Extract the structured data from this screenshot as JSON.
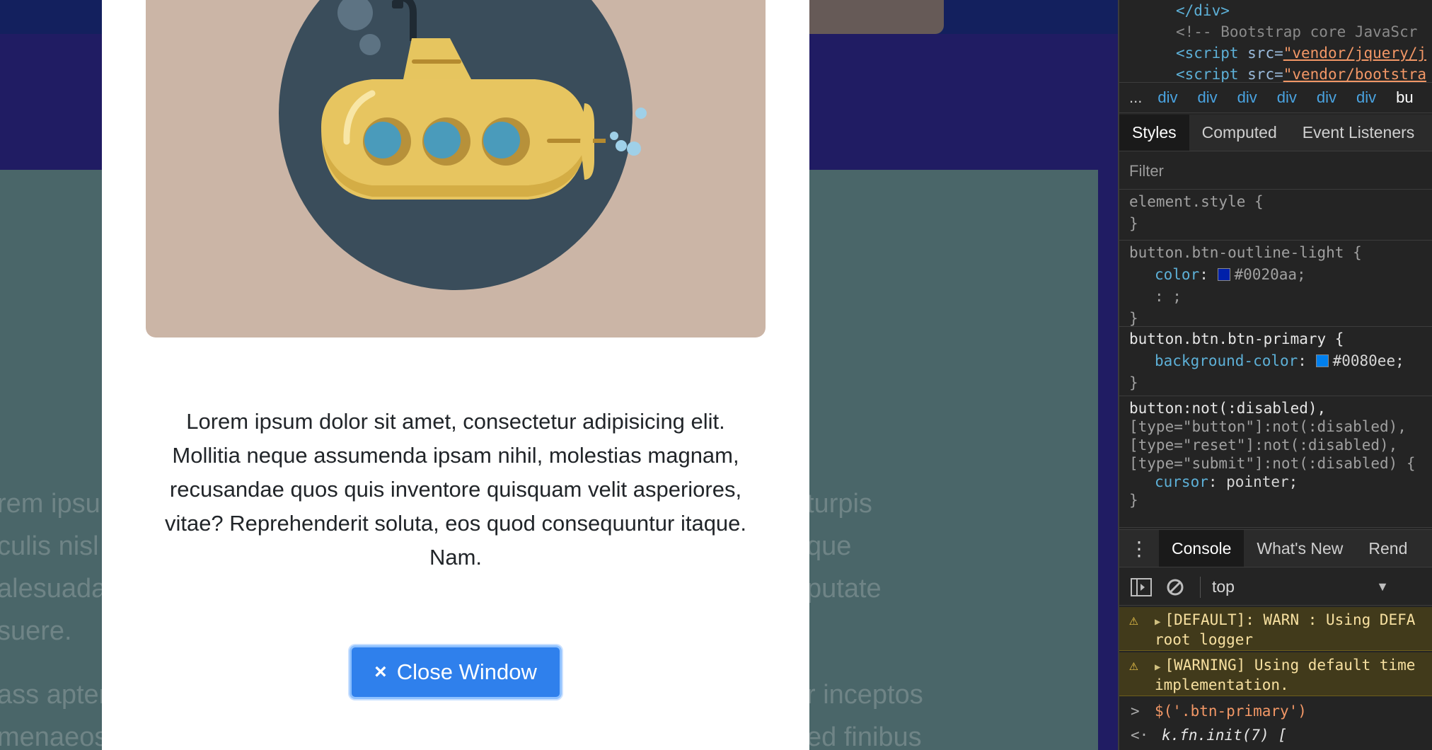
{
  "page": {
    "bg_left_lines": [
      "rem ipsu",
      "culis nisl p",
      "alesuada",
      "suere.",
      "ass apter",
      "menaeos"
    ],
    "bg_right_lines": [
      "turpis",
      "que",
      "putate",
      "",
      "r inceptos",
      "ed finibus"
    ]
  },
  "modal": {
    "image_alt": "submarine illustration",
    "text": "Lorem ipsum dolor sit amet, consectetur adipisicing elit. Mollitia neque assumenda ipsam nihil, molestias magnam, recusandae quos quis inventore quisquam velit asperiores, vitae? Reprehenderit soluta, eos quod consequuntur itaque. Nam.",
    "close_label": "Close Window",
    "close_icon": "×"
  },
  "devtools": {
    "source": {
      "line1": "</div>",
      "line2": "<!-- Bootstrap core JavaScr",
      "line3_tag": "<script",
      "line3_attr": " src=",
      "line3_val": "\"vendor/jquery/j",
      "line4_tag": "<script",
      "line4_attr": " src=",
      "line4_val": "\"vendor/bootstra"
    },
    "breadcrumbs": {
      "more": "...",
      "items": [
        "div",
        "div",
        "div",
        "div",
        "div",
        "div",
        "bu"
      ]
    },
    "styles_tabs": [
      "Styles",
      "Computed",
      "Event Listeners"
    ],
    "filter_placeholder": "Filter",
    "rules": {
      "element_selector": "element.style {",
      "close": "}",
      "outline_selector": "button.btn-outline-light {",
      "outline_prop": "color",
      "outline_val": "#0020aa;",
      "outline_empty": ": ;",
      "primary_selector": "button.btn.btn-primary {",
      "primary_prop": "background-color",
      "primary_val": "#0080ee;",
      "cursor_sel1": "button:not(:disabled),",
      "cursor_sel2": "[type=\"button\"]:not(:disabled),",
      "cursor_sel3": "[type=\"reset\"]:not(:disabled),",
      "cursor_sel4": "[type=\"submit\"]:not(:disabled) {",
      "cursor_prop": "cursor",
      "cursor_val": "pointer;"
    },
    "console_tabs": [
      "Console",
      "What's New",
      "Rend"
    ],
    "console_context": "top",
    "warnings": [
      {
        "line1": "[DEFAULT]: WARN : Using DEFA",
        "line2": "root logger"
      },
      {
        "line1": "[WARNING] Using default time",
        "line2": "implementation."
      }
    ],
    "input_line": "$('.btn-primary')",
    "output_line": "k.fn.init(7) ["
  },
  "colors": {
    "outline_swatch": "#0020aa",
    "primary_swatch": "#0080ee",
    "button_bg": "#2f80ec"
  }
}
